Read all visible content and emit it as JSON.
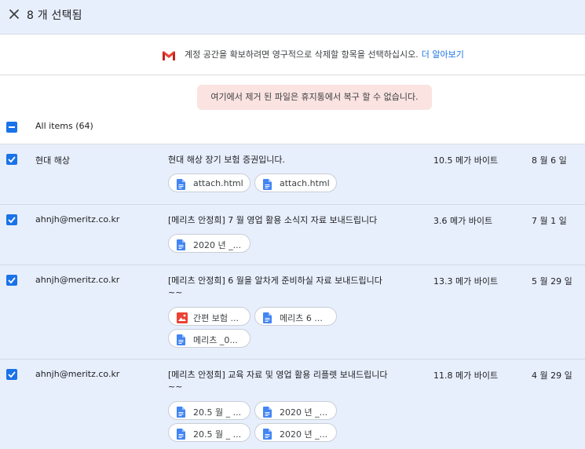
{
  "header": {
    "title": "8 개 선택됨"
  },
  "notice": {
    "text": "계정 공간을 확보하려면 영구적으로 삭제할 항목을 선택하십시오.",
    "link": "더 알아보기"
  },
  "warning": {
    "text": "여기에서 제거 된 파일은 휴지통에서 복구 할 수 없습니다."
  },
  "all_items": {
    "label": "All items (64)"
  },
  "rows": [
    {
      "sender": "현대 해상",
      "subject": "현대 해상 장기 보험 증권입니다.",
      "size": "10.5 메가 바이트",
      "date": "8 월 6 일",
      "attachments": [
        {
          "label": "attach.html",
          "icon": "doc-icon"
        },
        {
          "label": "attach.html",
          "icon": "doc-icon"
        }
      ]
    },
    {
      "sender": "ahnjh@meritz.co.kr",
      "subject": "[메리츠 안정희] 7 월 영업 활용 소식지 자료 보내드립니다",
      "size": "3.6 메가 바이트",
      "date": "7 월 1 일",
      "attachments": [
        {
          "label": "2020 년 _...",
          "icon": "doc-icon"
        }
      ]
    },
    {
      "sender": "ahnjh@meritz.co.kr",
      "subject": "[메리츠 안정희] 6 월을 알차게 준비하실 자료 보내드립니다 ~~",
      "size": "13.3 메가 바이트",
      "date": "5 월 29 일",
      "attachments": [
        {
          "label": "간편 보험 ...",
          "icon": "image-icon"
        },
        {
          "label": "메리츠 6 ...",
          "icon": "doc-icon"
        },
        {
          "label": "메리츠 _0...",
          "icon": "doc-icon"
        }
      ]
    },
    {
      "sender": "ahnjh@meritz.co.kr",
      "subject": "[메리츠 안정희] 교육 자료 및 영업 활용 리플렛 보내드립니다 ~~",
      "size": "11.8 메가 바이트",
      "date": "4 월 29 일",
      "attachments": [
        {
          "label": "20.5 월 _ ...",
          "icon": "doc-icon"
        },
        {
          "label": "2020 년 _...",
          "icon": "doc-icon"
        },
        {
          "label": "20.5 월 _ ...",
          "icon": "doc-icon"
        },
        {
          "label": "2020 년 _...",
          "icon": "doc-icon"
        }
      ]
    }
  ],
  "colors": {
    "accent": "#1a73e8",
    "selected_row": "#e8effc",
    "warning_bg": "#fbe3e1",
    "doc_icon": "#4285f4",
    "image_icon": "#ea4335"
  }
}
